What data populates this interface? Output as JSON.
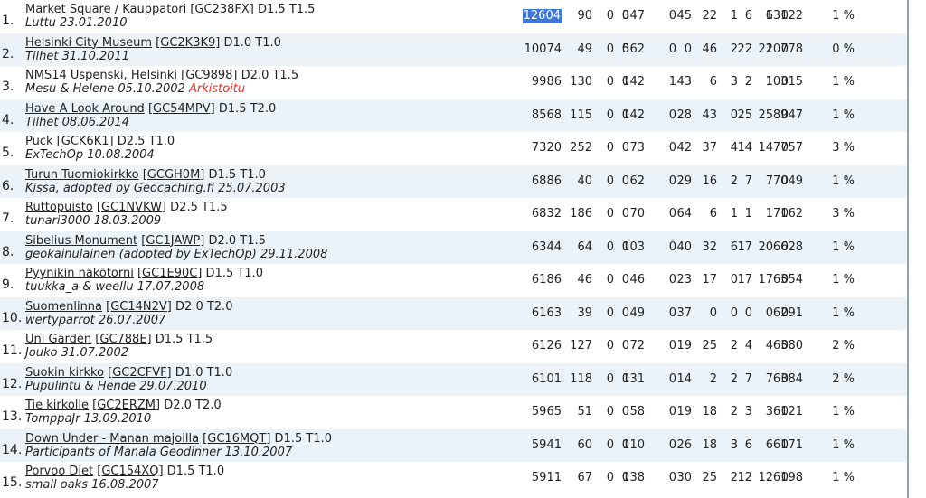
{
  "rows": [
    {
      "rank": "1.",
      "name": "Market Square / Kauppatori",
      "code": "[GC238FX]",
      "dt": "D1.5 T1.5",
      "owner": "Luttu 23.01.2010",
      "note": "",
      "total": "12604",
      "c": [
        "90",
        "0",
        "0",
        "347",
        "0",
        "45",
        "22",
        "1",
        "6",
        "6",
        "0",
        "13122",
        "1 %"
      ]
    },
    {
      "rank": "2.",
      "name": "Helsinki City Museum",
      "code": "[GC2K3K9]",
      "dt": "D1.0 T1.0",
      "owner": "Tilhet 31.10.2011",
      "note": "",
      "total": "10074",
      "c": [
        "49",
        "0",
        "0",
        "562",
        "0",
        "0",
        "46",
        "2",
        "22",
        "22",
        "0",
        "10778",
        "0 %"
      ]
    },
    {
      "rank": "3.",
      "name": "NMS14 Uspenski, Helsinki",
      "code": "[GC9898]",
      "dt": "D2.0 T1.5",
      "owner": "Mesu & Helene 05.10.2002",
      "note": "Arkistoitu",
      "total": "9986",
      "c": [
        "130",
        "0",
        "0",
        "142",
        "1",
        "43",
        "6",
        "3",
        "2",
        "1",
        "0",
        "10315",
        "1 %"
      ]
    },
    {
      "rank": "4.",
      "name": "Have A Look Around",
      "code": "[GC54MPV]",
      "dt": "D1.5 T2.0",
      "owner": "Tilhet 08.06.2014",
      "note": "",
      "total": "8568",
      "c": [
        "115",
        "0",
        "0",
        "142",
        "0",
        "28",
        "43",
        "0",
        "25",
        "25",
        "0",
        "8947",
        "1 %"
      ]
    },
    {
      "rank": "5.",
      "name": "Puck",
      "code": "[GCK6K1]",
      "dt": "D2.5 T1.0",
      "owner": "ExTechOp 10.08.2004",
      "note": "",
      "total": "7320",
      "c": [
        "252",
        "0",
        "0",
        "73",
        "0",
        "42",
        "37",
        "4",
        "14",
        "14",
        "0",
        "7757",
        "3 %"
      ]
    },
    {
      "rank": "6.",
      "name": "Turun Tuomiokirkko",
      "code": "[GCGH0M]",
      "dt": "D1.5 T1.0",
      "owner": "Kissa, adopted by Geocaching.fi 25.07.2003",
      "note": "",
      "total": "6886",
      "c": [
        "40",
        "0",
        "0",
        "62",
        "0",
        "29",
        "16",
        "2",
        "7",
        "7",
        "0",
        "7049",
        "1 %"
      ]
    },
    {
      "rank": "7.",
      "name": "Ruttopuisto",
      "code": "[GC1NVKW]",
      "dt": "D2.5 T1.5",
      "owner": "tunari3000 18.03.2009",
      "note": "",
      "total": "6832",
      "c": [
        "186",
        "0",
        "0",
        "70",
        "0",
        "64",
        "6",
        "1",
        "1",
        "1",
        "0",
        "7162",
        "3 %"
      ]
    },
    {
      "rank": "8.",
      "name": "Sibelius Monument",
      "code": "[GC1JAWP]",
      "dt": "D2.0 T1.5",
      "owner": "geokainulainen (adopted by ExTechOp) 29.11.2008",
      "note": "",
      "total": "6344",
      "c": [
        "64",
        "0",
        "0",
        "103",
        "0",
        "40",
        "32",
        "6",
        "17",
        "20",
        "0",
        "6628",
        "1 %"
      ]
    },
    {
      "rank": "9.",
      "name": "Pyynikin näkötorni",
      "code": "[GC1E90C]",
      "dt": "D1.5 T1.0",
      "owner": "tuukka_a & weellu 17.07.2008",
      "note": "",
      "total": "6186",
      "c": [
        "46",
        "0",
        "0",
        "46",
        "0",
        "23",
        "17",
        "0",
        "17",
        "17",
        "0",
        "6354",
        "1 %"
      ]
    },
    {
      "rank": "10.",
      "name": "Suomenlinna",
      "code": "[GC14N2V]",
      "dt": "D2.0 T2.0",
      "owner": "wertyparrot 26.07.2007",
      "note": "",
      "total": "6163",
      "c": [
        "39",
        "0",
        "0",
        "49",
        "0",
        "37",
        "0",
        "0",
        "0",
        "0",
        "0",
        "6291",
        "1 %"
      ]
    },
    {
      "rank": "11.",
      "name": "Uni Garden",
      "code": "[GC788E]",
      "dt": "D1.5 T1.5",
      "owner": "Jouko 31.07.2002",
      "note": "",
      "total": "6126",
      "c": [
        "127",
        "0",
        "0",
        "72",
        "0",
        "19",
        "25",
        "2",
        "4",
        "4",
        "0",
        "6380",
        "2 %"
      ]
    },
    {
      "rank": "12.",
      "name": "Suokin kirkko",
      "code": "[GC2CFVF]",
      "dt": "D1.0 T1.0",
      "owner": "Pupulintu & Hende 29.07.2010",
      "note": "",
      "total": "6101",
      "c": [
        "118",
        "0",
        "0",
        "131",
        "0",
        "14",
        "2",
        "2",
        "7",
        "7",
        "0",
        "6384",
        "2 %"
      ]
    },
    {
      "rank": "13.",
      "name": "Tie kirkolle",
      "code": "[GC2ERZM]",
      "dt": "D2.0 T2.0",
      "owner": "TomppaJr 13.09.2010",
      "note": "",
      "total": "5965",
      "c": [
        "51",
        "0",
        "0",
        "58",
        "0",
        "19",
        "18",
        "2",
        "3",
        "3",
        "0",
        "6121",
        "1 %"
      ]
    },
    {
      "rank": "14.",
      "name": "Down Under - Manan majoilla",
      "code": "[GC16MQT]",
      "dt": "D1.5 T1.0",
      "owner": "Participants of Manala Geodinner 13.10.2007",
      "note": "",
      "total": "5941",
      "c": [
        "60",
        "0",
        "0",
        "110",
        "0",
        "26",
        "18",
        "3",
        "6",
        "6",
        "0",
        "6171",
        "1 %"
      ]
    },
    {
      "rank": "15.",
      "name": "Porvoo Diet",
      "code": "[GC154XQ]",
      "dt": "D1.5 T1.0",
      "owner": "small oaks 16.08.2007",
      "note": "",
      "total": "5911",
      "c": [
        "67",
        "0",
        "0",
        "138",
        "0",
        "30",
        "25",
        "2",
        "12",
        "12",
        "0",
        "6198",
        "1 %"
      ]
    }
  ]
}
